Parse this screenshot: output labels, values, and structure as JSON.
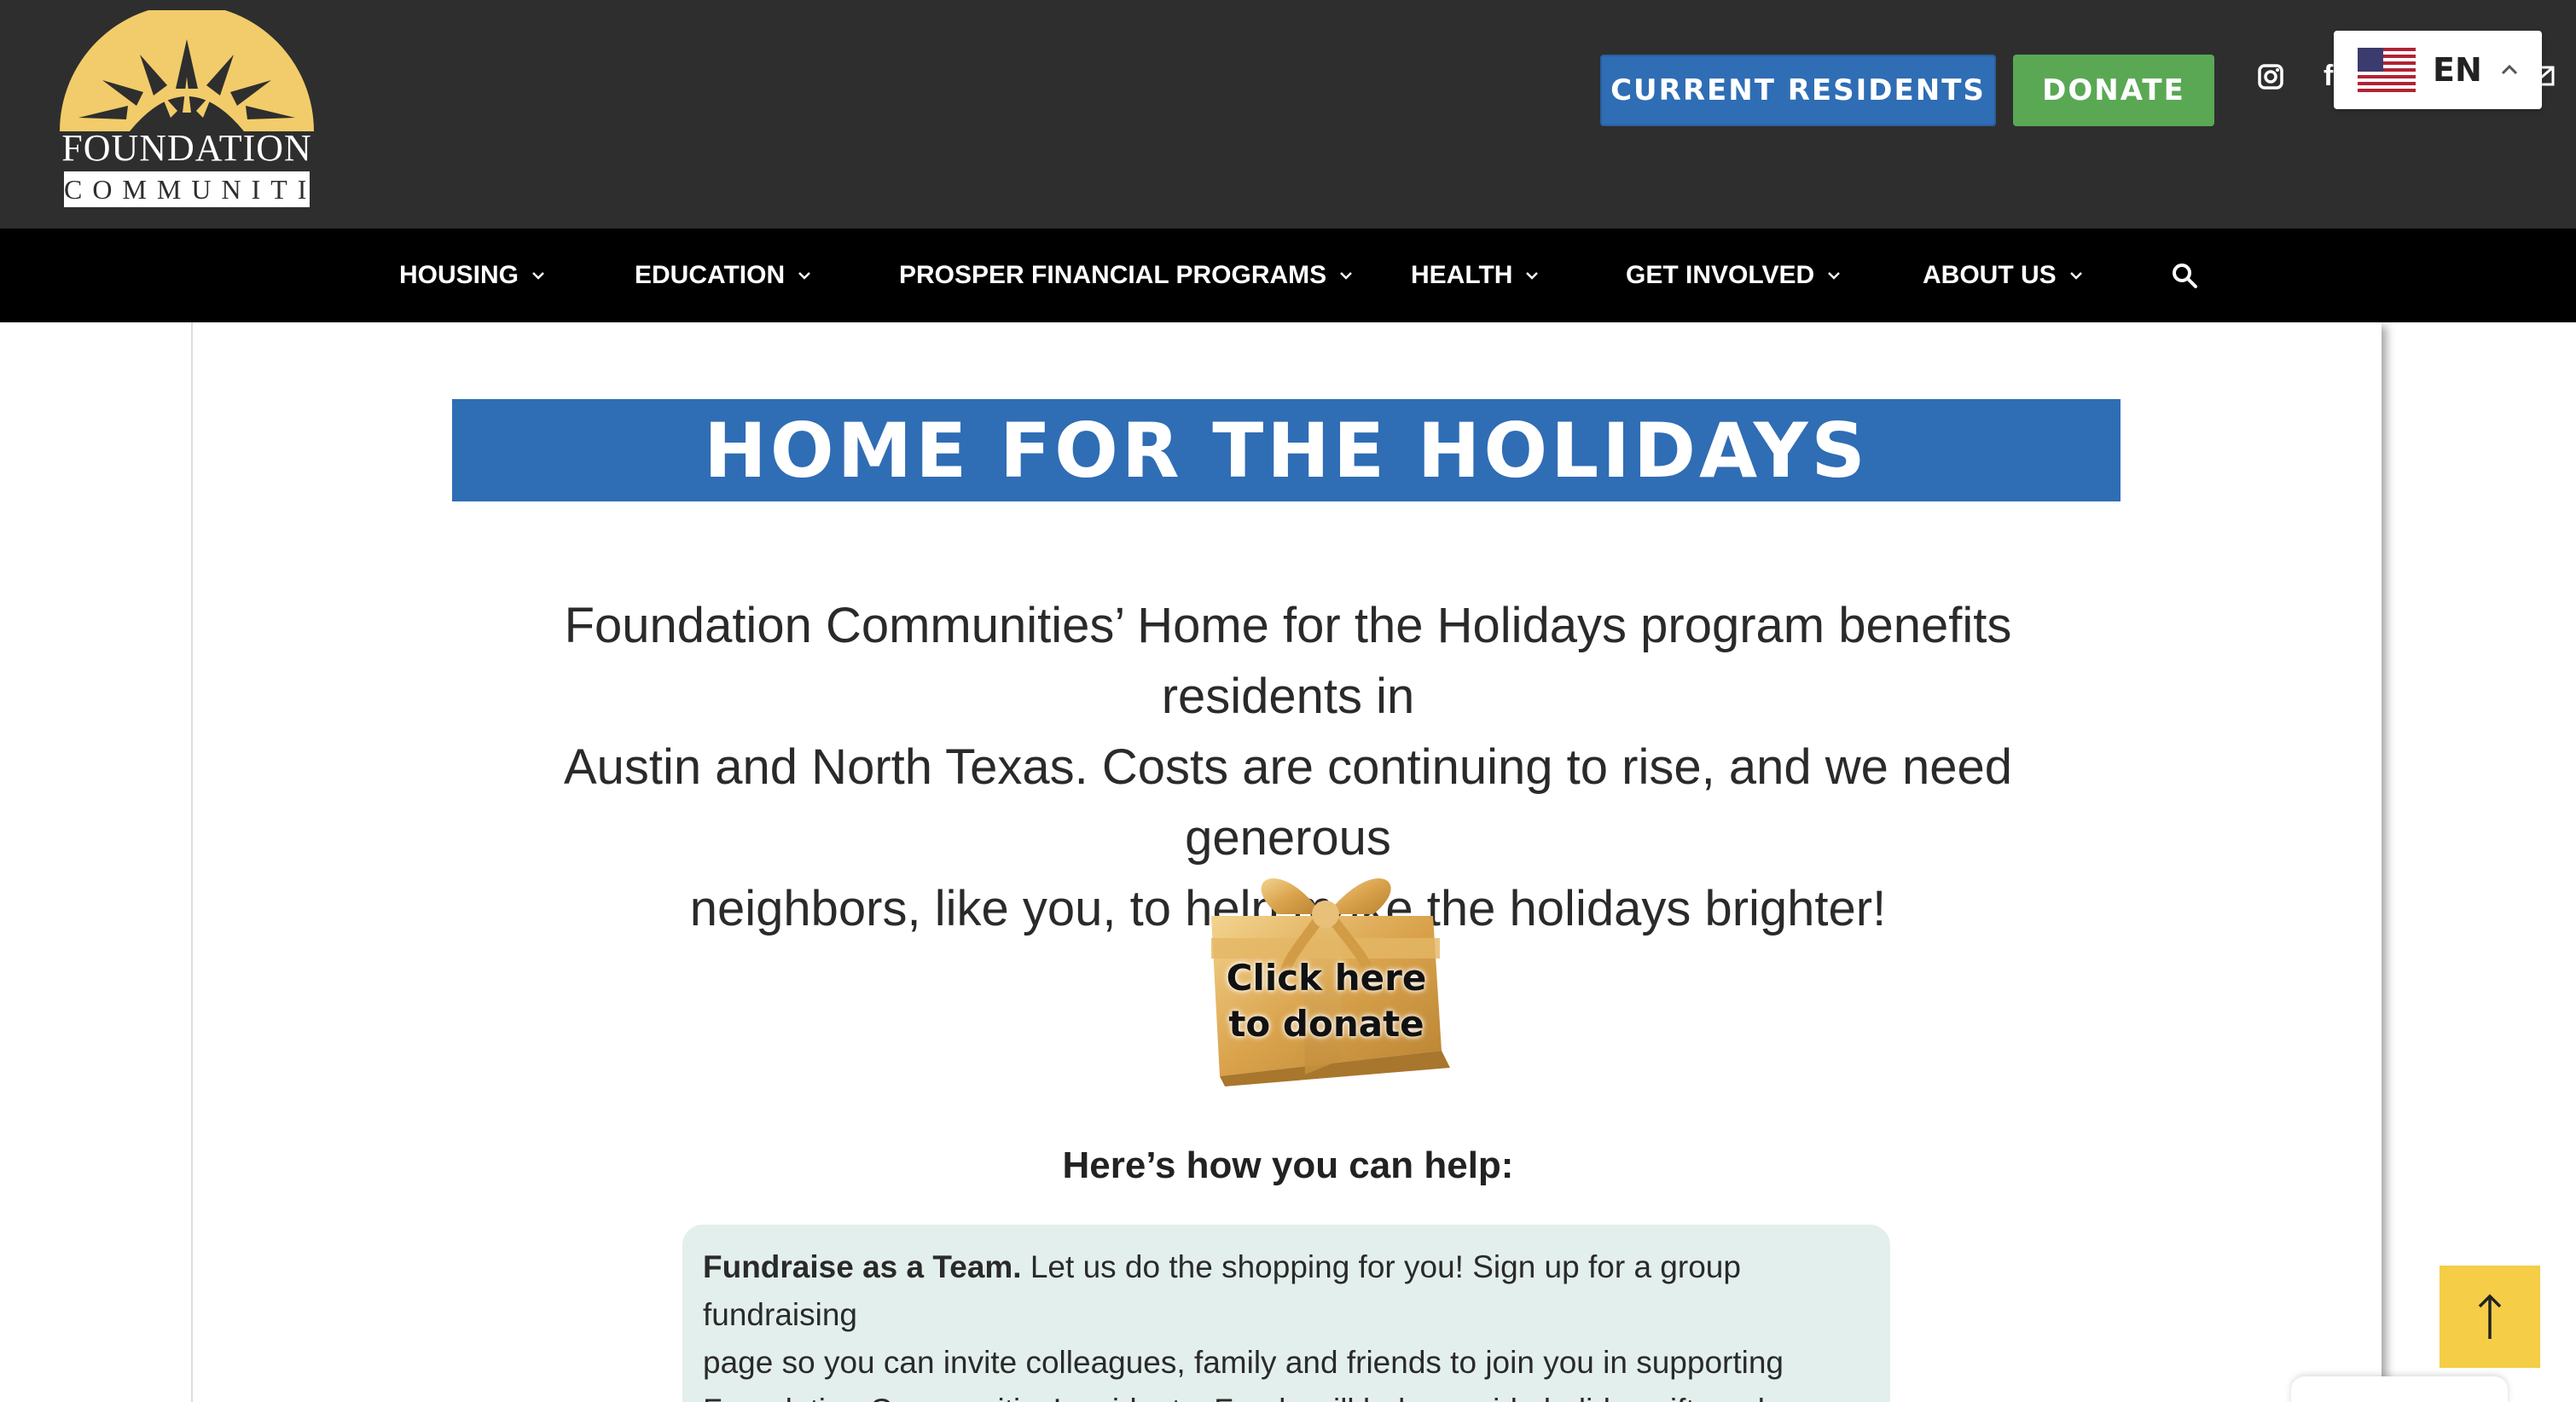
{
  "brand": {
    "name_line1": "FOUNDATION",
    "name_line2": "COMMUNITIES",
    "sun_color": "#f2cc6a"
  },
  "header": {
    "residents_label": "CURRENT RESIDENTS",
    "donate_label": "DONATE",
    "social_icons": [
      "instagram-icon",
      "facebook-icon",
      "mail-icon"
    ],
    "language": {
      "code": "EN",
      "flag": "us-flag-icon"
    }
  },
  "nav": {
    "items": [
      {
        "label": "HOUSING"
      },
      {
        "label": "EDUCATION"
      },
      {
        "label": "PROSPER FINANCIAL PROGRAMS"
      },
      {
        "label": "HEALTH"
      },
      {
        "label": "GET INVOLVED"
      },
      {
        "label": "ABOUT US"
      }
    ],
    "search_icon": "search-icon"
  },
  "main": {
    "title": "HOME FOR THE HOLIDAYS",
    "intro_line1": "Foundation Communities’ Home for the Holidays program benefits residents in",
    "intro_line2": "Austin and North Texas. Costs are continuing to rise, and we need generous",
    "intro_line3": "neighbors, like you, to help make the holidays brighter!",
    "gift": {
      "line1": "Click here",
      "line2": "to donate"
    },
    "help_heading": "Here’s how you can help:",
    "tip": {
      "bold": "Fundraise as a Team.",
      "line1": " Let us do the shopping for you! Sign up for a group fundraising",
      "line2": "page so you can invite colleagues, family and friends to join you in supporting",
      "line3": "Foundation Communities’ residents. Funds will help provide holiday gift cards"
    }
  },
  "colors": {
    "topbar": "#2e2e2e",
    "nav": "#000000",
    "primary_blue": "#2f6db5",
    "donate_green": "#5aa854",
    "tip_bg": "#e3efec",
    "scroll_top": "#f5cd47"
  },
  "scroll_top_icon": "arrow-up-icon"
}
